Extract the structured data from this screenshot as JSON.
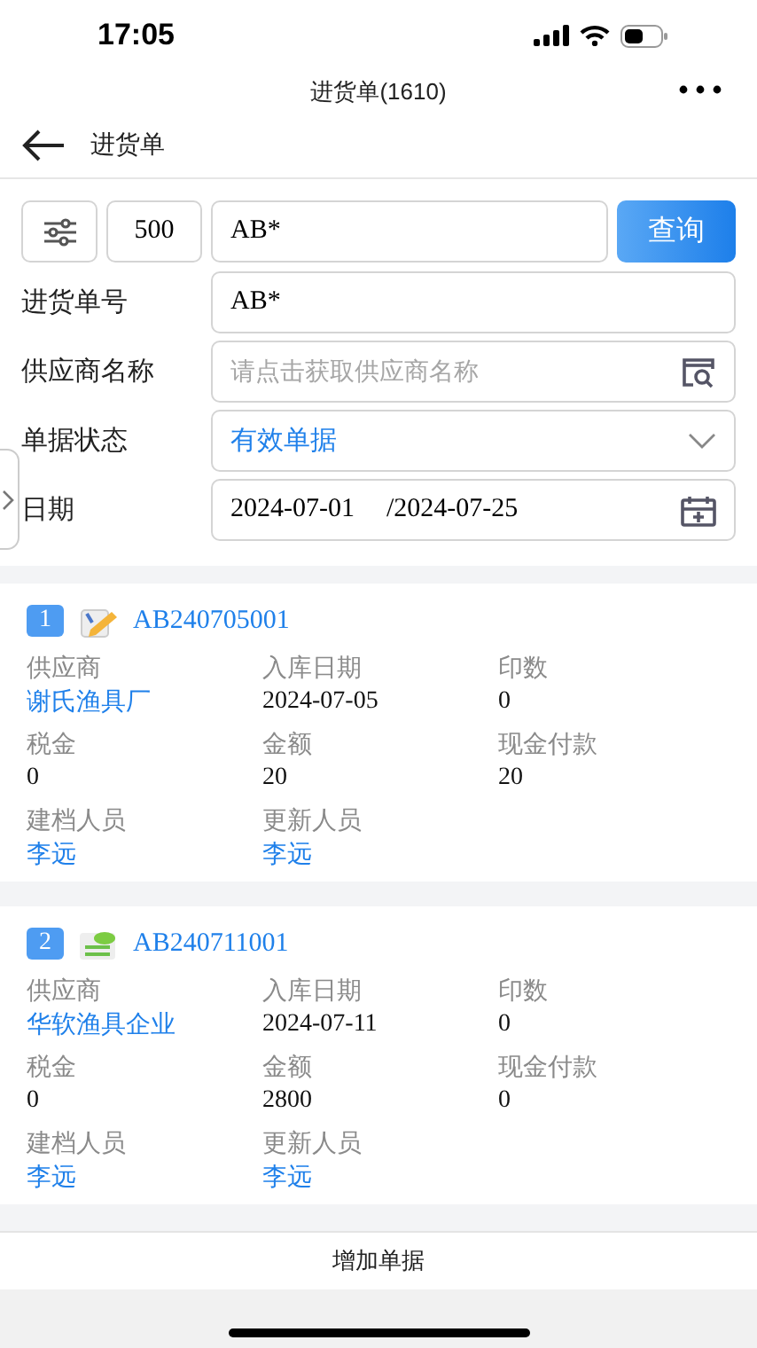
{
  "status_bar": {
    "time": "17:05"
  },
  "title_bar": {
    "title": "进货单(1610)"
  },
  "header": {
    "title": "进货单"
  },
  "filter": {
    "count": "500",
    "keyword": "AB*",
    "search_button": "查询",
    "fields": [
      {
        "kind": "text",
        "label": "进货单号",
        "value": "AB*"
      },
      {
        "kind": "picker",
        "label": "供应商名称",
        "placeholder": "请点击获取供应商名称"
      },
      {
        "kind": "select",
        "label": "单据状态",
        "value": "有效单据"
      },
      {
        "kind": "date",
        "label": "日期",
        "from": "2024-07-01",
        "to": "/2024-07-25"
      }
    ]
  },
  "orders": [
    {
      "index": "1",
      "kind": "pencil",
      "number": "AB240705001",
      "fields": [
        {
          "label": "供应商",
          "value": "谢氏渔具厂",
          "linked": true
        },
        {
          "label": "入库日期",
          "value": "2024-07-05",
          "linked": false
        },
        {
          "label": "印数",
          "value": "0",
          "linked": false
        },
        {
          "label": "税金",
          "value": "0",
          "linked": false
        },
        {
          "label": "金额",
          "value": "20",
          "linked": false
        },
        {
          "label": "现金付款",
          "value": "20",
          "linked": false
        },
        {
          "label": "建档人员",
          "value": "李远",
          "linked": true
        },
        {
          "label": "更新人员",
          "value": "李远",
          "linked": true
        }
      ]
    },
    {
      "index": "2",
      "kind": "sheet",
      "number": "AB240711001",
      "fields": [
        {
          "label": "供应商",
          "value": "华软渔具企业",
          "linked": true
        },
        {
          "label": "入库日期",
          "value": "2024-07-11",
          "linked": false
        },
        {
          "label": "印数",
          "value": "0",
          "linked": false
        },
        {
          "label": "税金",
          "value": "0",
          "linked": false
        },
        {
          "label": "金额",
          "value": "2800",
          "linked": false
        },
        {
          "label": "现金付款",
          "value": "0",
          "linked": false
        },
        {
          "label": "建档人员",
          "value": "李远",
          "linked": true
        },
        {
          "label": "更新人员",
          "value": "李远",
          "linked": true
        }
      ]
    }
  ],
  "bottom_bar": {
    "action": "增加单据"
  }
}
